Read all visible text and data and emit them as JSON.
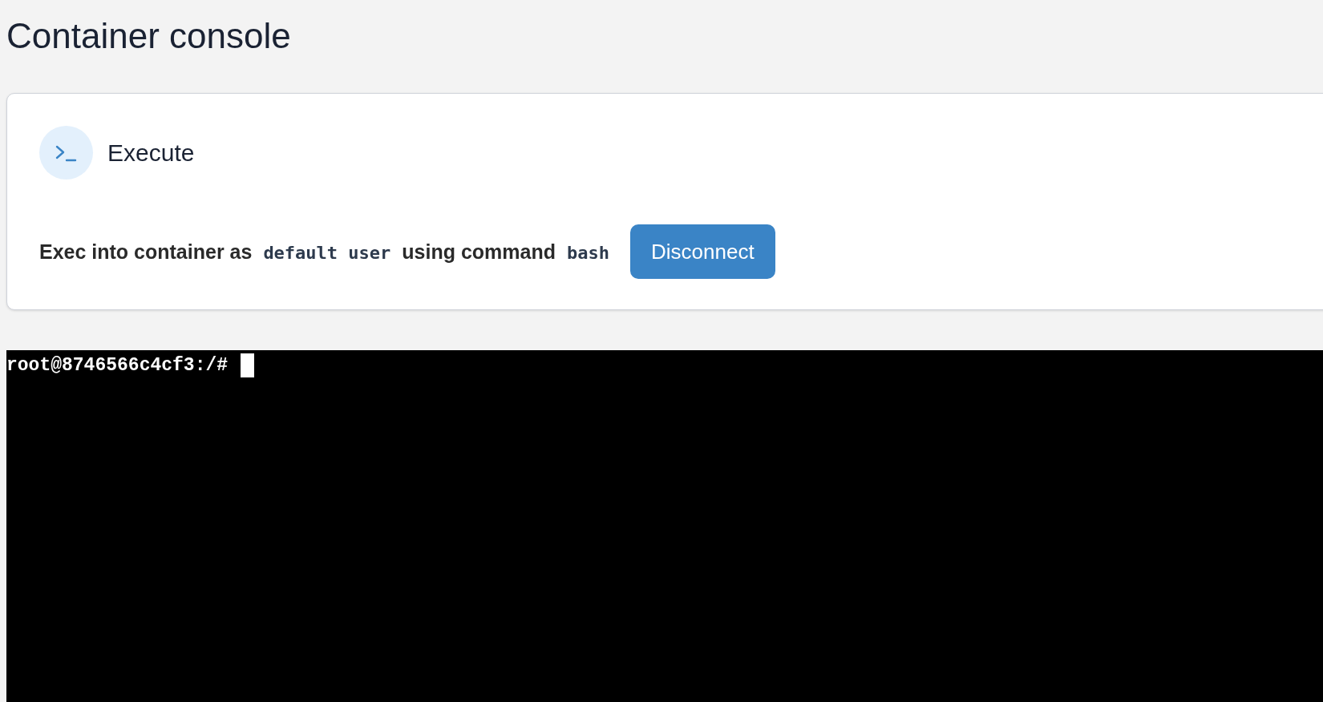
{
  "page": {
    "title": "Container console"
  },
  "exec_card": {
    "title": "Execute",
    "description": [
      {
        "kind": "text",
        "text": "Exec into container as"
      },
      {
        "kind": "code",
        "text": "default user"
      },
      {
        "kind": "text",
        "text": "using command"
      },
      {
        "kind": "code",
        "text": "bash"
      }
    ],
    "button": {
      "label": "Disconnect"
    }
  },
  "terminal": {
    "lines": [
      "root@8746566c4cf3:/#"
    ],
    "cursor": true
  }
}
